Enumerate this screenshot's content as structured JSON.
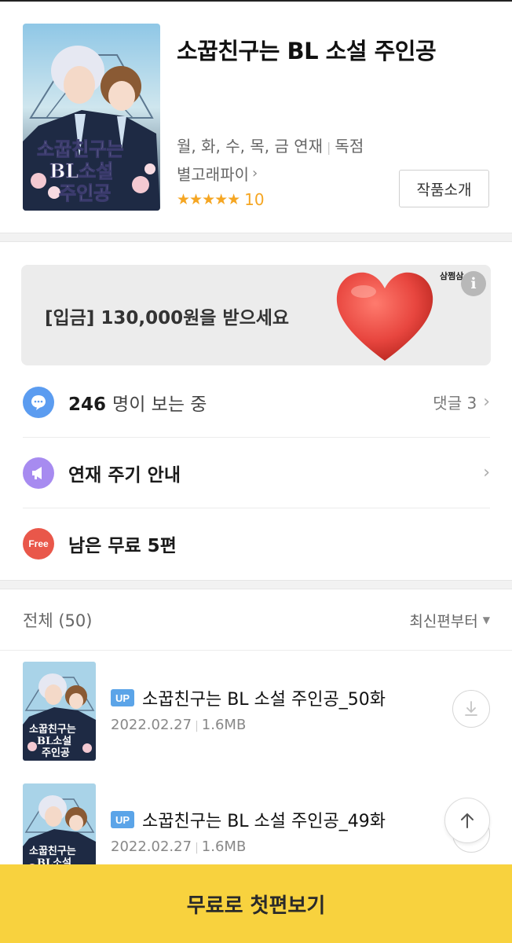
{
  "work": {
    "title": "소꿉친구는 BL 소설 주인공",
    "schedule": "월, 화, 수, 목, 금 연재",
    "exclusive": "독점",
    "author": "별고래파이",
    "stars": "★★★★★",
    "rating": "10",
    "intro_button": "작품소개",
    "cover_icon": "book-cover-illustration"
  },
  "banner": {
    "text": "[입금] 130,000원을 받으세요",
    "tag": "삼쩜삼",
    "info_glyph": "i",
    "heart_color": "#e8463f"
  },
  "rows": {
    "viewers": {
      "count": "246",
      "suffix": "명이 보는 중",
      "comments": "댓글 3",
      "icon": "chat-bubble-icon",
      "color": "#5b9cf0"
    },
    "schedule_notice": {
      "label": "연재 주기 안내",
      "icon": "megaphone-icon",
      "color": "#a78bf0"
    },
    "free": {
      "label": "남은 무료 5편",
      "icon_text": "Free",
      "color": "#e9574a"
    }
  },
  "list": {
    "total": "전체 (50)",
    "sort": "최신편부터",
    "episodes": [
      {
        "badge": "UP",
        "title": "소꿉친구는 BL 소설 주인공_50화",
        "date": "2022.02.27",
        "size": "1.6MB"
      },
      {
        "badge": "UP",
        "title": "소꿉친구는 BL 소설 주인공_49화",
        "date": "2022.02.27",
        "size": "1.6MB"
      }
    ]
  },
  "cta": {
    "label": "무료로 첫편보기",
    "color": "#f8d23e"
  },
  "chevron": "›"
}
